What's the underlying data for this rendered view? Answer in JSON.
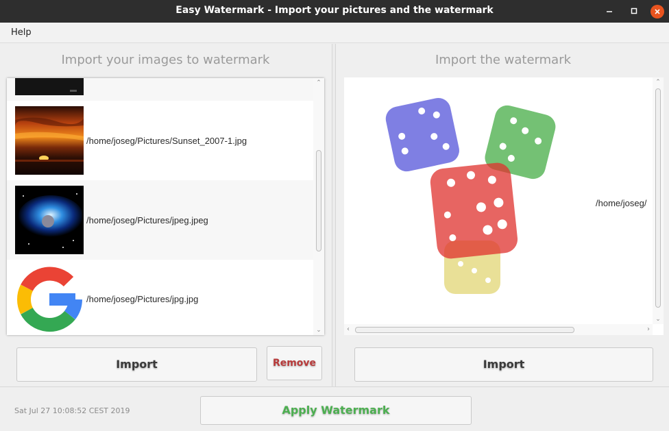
{
  "window": {
    "title": "Easy Watermark - Import your pictures and the watermark"
  },
  "menubar": {
    "help_label": "Help"
  },
  "left_panel": {
    "heading": "Import your images to watermark",
    "images": [
      {
        "path": "/home/joseg/Pictures/Sunset_2007-1.jpg",
        "thumb": "sunset"
      },
      {
        "path": "/home/joseg/Pictures/jpeg.jpeg",
        "thumb": "space"
      },
      {
        "path": "/home/joseg/Pictures/jpg.jpg",
        "thumb": "google-logo"
      }
    ],
    "import_label": "Import",
    "remove_label": "Remove"
  },
  "right_panel": {
    "heading": "Import the watermark",
    "watermark_path": "/home/joseg/",
    "import_label": "Import"
  },
  "status": {
    "timestamp": "Sat Jul 27 10:08:52 CEST 2019",
    "apply_label": "Apply Watermark"
  },
  "colors": {
    "accent_green": "#4caf50",
    "remove_red": "#b83a3a",
    "titlebar": "#2e2e2e",
    "close_button": "#e9541f"
  }
}
